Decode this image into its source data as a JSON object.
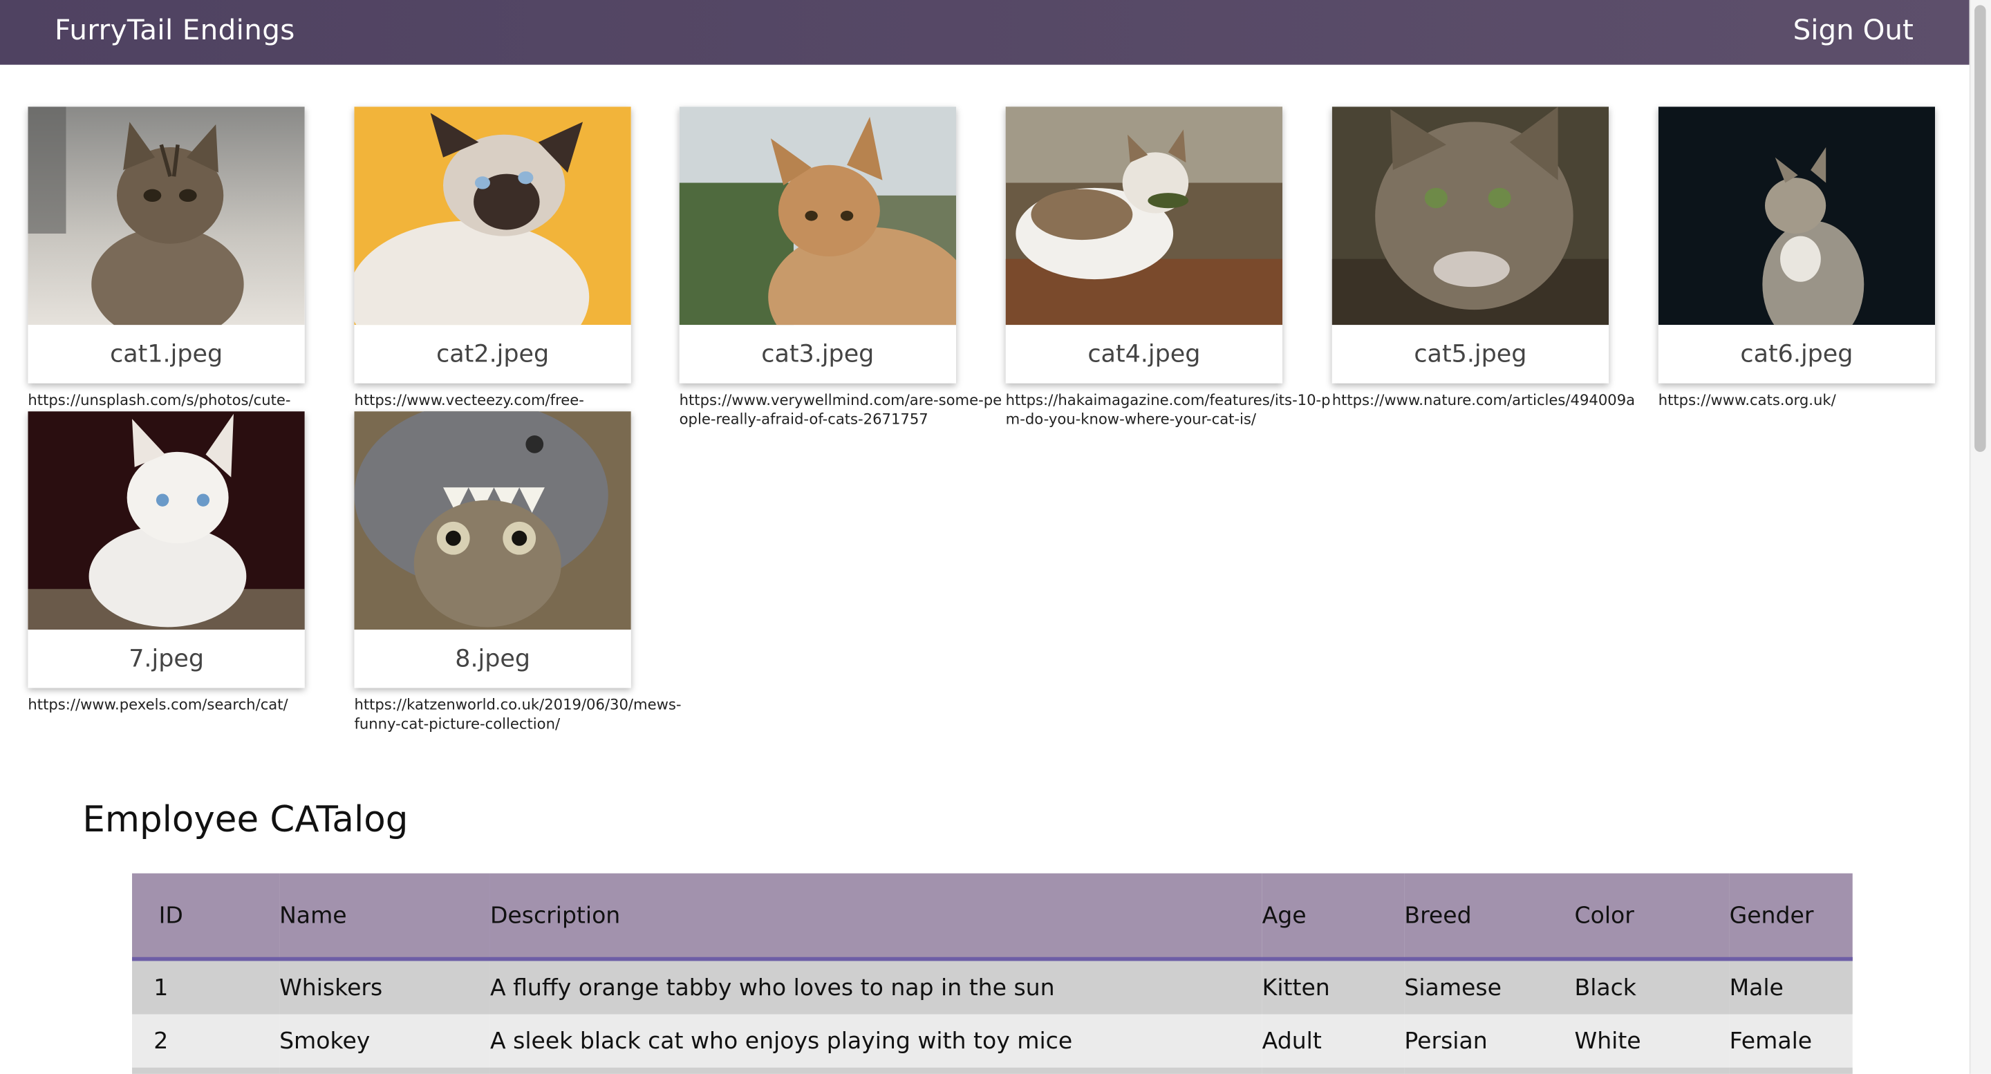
{
  "header": {
    "brand": "FurryTail Endings",
    "sign_out_label": "Sign Out"
  },
  "gallery": [
    {
      "label": "cat1.jpeg",
      "url": "https://unsplash.com/s/photos/cute-"
    },
    {
      "label": "cat2.jpeg",
      "url": "https://www.vecteezy.com/free-"
    },
    {
      "label": "cat3.jpeg",
      "url": "https://www.verywellmind.com/are-some-people-really-afraid-of-cats-2671757"
    },
    {
      "label": "cat4.jpeg",
      "url": "https://hakaimagazine.com/features/its-10-pm-do-you-know-where-your-cat-is/"
    },
    {
      "label": "cat5.jpeg",
      "url": "https://www.nature.com/articles/494009a"
    },
    {
      "label": "cat6.jpeg",
      "url": "https://www.cats.org.uk/"
    },
    {
      "label": "7.jpeg",
      "url": "https://www.pexels.com/search/cat/"
    },
    {
      "label": "8.jpeg",
      "url": "https://katzenworld.co.uk/2019/06/30/mews-funny-cat-picture-collection/"
    }
  ],
  "catalog": {
    "title": "Employee CATalog",
    "columns": [
      "ID",
      "Name",
      "Description",
      "Age",
      "Breed",
      "Color",
      "Gender"
    ],
    "rows": [
      [
        "1",
        "Whiskers",
        "A fluffy orange tabby who loves to nap in the sun",
        "Kitten",
        "Siamese",
        "Black",
        "Male"
      ],
      [
        "2",
        "Smokey",
        "A sleek black cat who enjoys playing with toy mice",
        "Adult",
        "Persian",
        "White",
        "Female"
      ],
      [
        "",
        "",
        "",
        "",
        "",
        "",
        ""
      ]
    ]
  },
  "colors": {
    "navbar": "#4f4261",
    "table_header": "#a292ad",
    "table_header_border": "#6d5ea6",
    "row_odd": "#cfcfcf",
    "row_even": "#ebebeb"
  }
}
